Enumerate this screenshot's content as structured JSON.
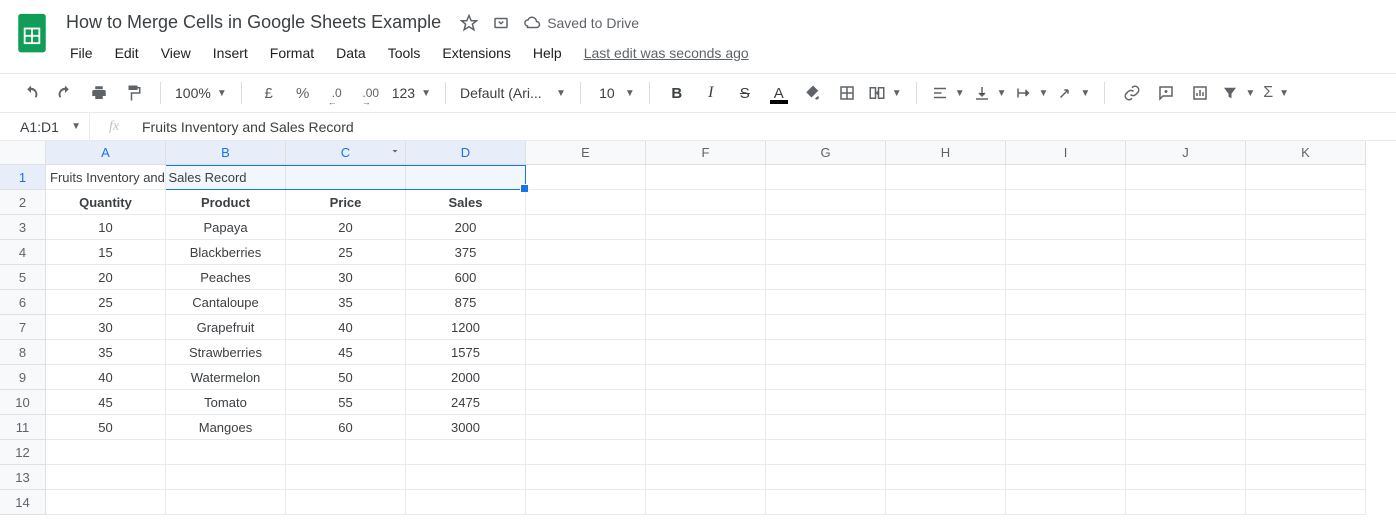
{
  "doc": {
    "title": "How to Merge Cells in Google Sheets Example",
    "saved_label": "Saved to Drive",
    "last_edit": "Last edit was seconds ago"
  },
  "menus": [
    "File",
    "Edit",
    "View",
    "Insert",
    "Format",
    "Data",
    "Tools",
    "Extensions",
    "Help"
  ],
  "toolbar": {
    "zoom": "100%",
    "currency_symbol": "£",
    "percent_symbol": "%",
    "dec_less": ".0",
    "dec_more": ".00",
    "num_format": "123",
    "font": "Default (Ari...",
    "font_size": "10",
    "bold": "B",
    "italic": "I",
    "strike": "S",
    "text_color_letter": "A"
  },
  "formula": {
    "namebox": "A1:D1",
    "fx": "fx",
    "content": "Fruits Inventory and Sales Record"
  },
  "grid": {
    "columns": [
      "A",
      "B",
      "C",
      "D",
      "E",
      "F",
      "G",
      "H",
      "I",
      "J",
      "K"
    ],
    "row_count": 14,
    "selected_cols": [
      "A",
      "B",
      "C",
      "D"
    ],
    "selected_row": 1,
    "selection_text": "Fruits Inventory and Sales Record",
    "headers_row": {
      "q": "Quantity",
      "p": "Product",
      "r": "Price",
      "s": "Sales"
    },
    "data": [
      {
        "q": "10",
        "p": "Papaya",
        "r": "20",
        "s": "200"
      },
      {
        "q": "15",
        "p": "Blackberries",
        "r": "25",
        "s": "375"
      },
      {
        "q": "20",
        "p": "Peaches",
        "r": "30",
        "s": "600"
      },
      {
        "q": "25",
        "p": "Cantaloupe",
        "r": "35",
        "s": "875"
      },
      {
        "q": "30",
        "p": "Grapefruit",
        "r": "40",
        "s": "1200"
      },
      {
        "q": "35",
        "p": "Strawberries",
        "r": "45",
        "s": "1575"
      },
      {
        "q": "40",
        "p": "Watermelon",
        "r": "50",
        "s": "2000"
      },
      {
        "q": "45",
        "p": "Tomato",
        "r": "55",
        "s": "2475"
      },
      {
        "q": "50",
        "p": "Mangoes",
        "r": "60",
        "s": "3000"
      }
    ]
  },
  "colors": {
    "accent": "#1a73e8",
    "logo": "#0f9d58"
  }
}
